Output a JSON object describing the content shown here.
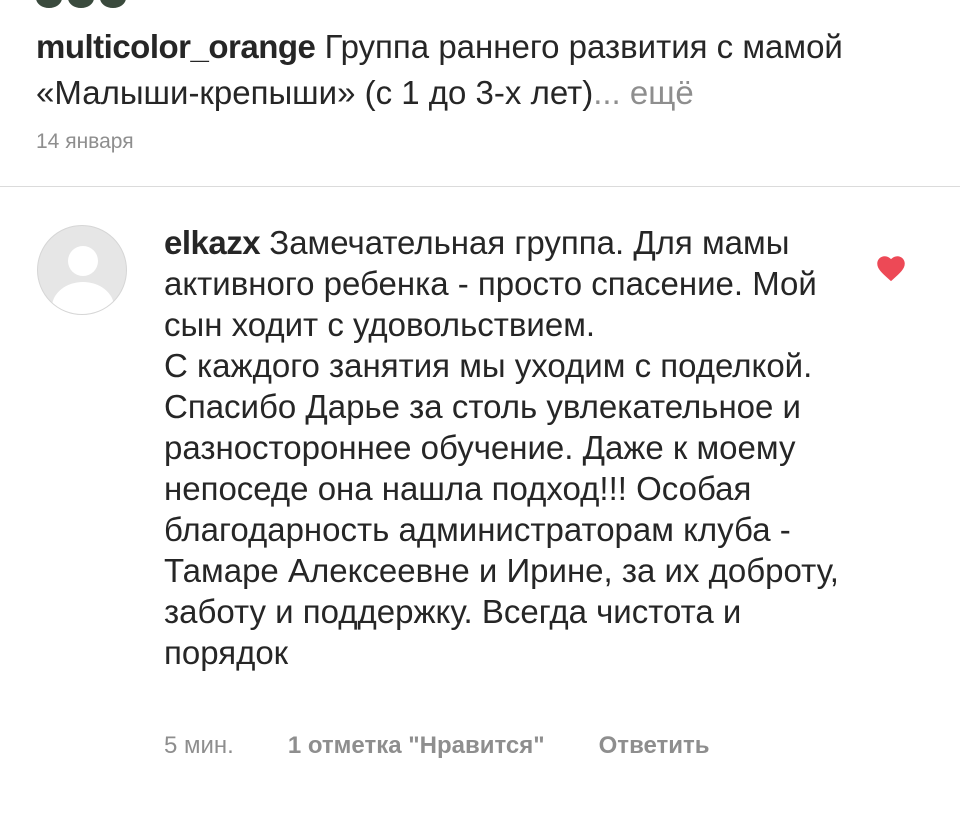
{
  "post": {
    "username": "multicolor_orange",
    "caption": "Группа раннего развития с мамой «Малыши-крепыши» (с 1 до 3-х лет)",
    "ellipsis": "...",
    "more_label": "ещё",
    "date": "14 января"
  },
  "comment": {
    "username": "elkazx",
    "text": "Замечательная группа. Для мамы активного ребенка - просто спасение. Мой сын ходит с удовольствием.\nС каждого занятия мы уходим с поделкой. Спасибо Дарье за столь увлекательное и разностороннее обучение. Даже к моему непоседе она нашла подход!!! Особая благодарность администраторам клуба - Тамаре Алексеевне и Ирине, за их доброту, заботу и поддержку. Всегда чистота и порядок",
    "time": "5 мин.",
    "likes_label": "1 отметка \"Нравится\"",
    "reply_label": "Ответить",
    "liked": true
  },
  "colors": {
    "text": "#262626",
    "secondary": "#8e8e8e",
    "divider": "#dbdbdb",
    "heart": "#ed4956"
  },
  "icons": {
    "like": "heart-filled-icon",
    "avatar": "default-avatar-icon"
  }
}
